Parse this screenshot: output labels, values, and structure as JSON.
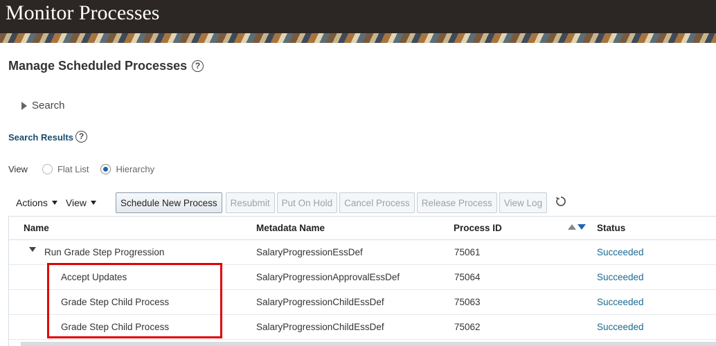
{
  "banner": {
    "title": "Monitor Processes"
  },
  "page": {
    "heading": "Manage Scheduled Processes",
    "help_icon": "?"
  },
  "search": {
    "label": "Search"
  },
  "results": {
    "heading": "Search Results",
    "help_icon": "?"
  },
  "view": {
    "label": "View",
    "options": [
      {
        "label": "Flat List",
        "selected": false
      },
      {
        "label": "Hierarchy",
        "selected": true
      }
    ]
  },
  "toolbar": {
    "actions_label": "Actions",
    "view_label": "View",
    "buttons": [
      {
        "label": "Schedule New Process",
        "enabled": true
      },
      {
        "label": "Resubmit",
        "enabled": false
      },
      {
        "label": "Put On Hold",
        "enabled": false
      },
      {
        "label": "Cancel Process",
        "enabled": false
      },
      {
        "label": "Release Process",
        "enabled": false
      },
      {
        "label": "View Log",
        "enabled": false
      }
    ],
    "refresh_icon": "refresh-icon"
  },
  "table": {
    "headers": {
      "name": "Name",
      "metadata": "Metadata Name",
      "process_id": "Process ID",
      "status": "Status"
    },
    "rows": [
      {
        "name": "Run Grade Step Progression",
        "metadata": "SalaryProgressionEssDef",
        "process_id": "75061",
        "status": "Succeeded",
        "level": 0
      },
      {
        "name": "Accept Updates",
        "metadata": "SalaryProgressionApprovalEssDef",
        "process_id": "75064",
        "status": "Succeeded",
        "level": 1
      },
      {
        "name": "Grade Step Child Process",
        "metadata": "SalaryProgressionChildEssDef",
        "process_id": "75063",
        "status": "Succeeded",
        "level": 1
      },
      {
        "name": "Grade Step Child Process",
        "metadata": "SalaryProgressionChildEssDef",
        "process_id": "75062",
        "status": "Succeeded",
        "level": 1
      }
    ]
  },
  "colors": {
    "status_link": "#1a6a93",
    "highlight": "#e10000",
    "radio_selected": "#1f65b6"
  }
}
